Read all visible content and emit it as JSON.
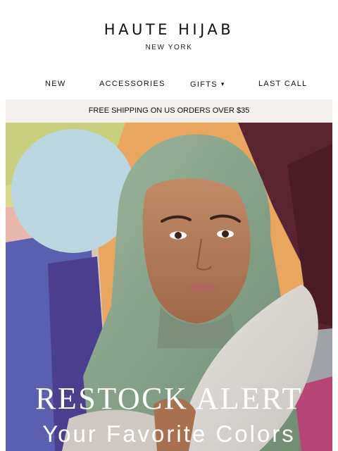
{
  "brand": {
    "title": "HAUTE HIJAB",
    "subtitle": "NEW YORK"
  },
  "nav": {
    "items": [
      {
        "label": "NEW"
      },
      {
        "label": "ACCESSORIES"
      },
      {
        "label": "GIFTS",
        "icon": "chevron-down-icon"
      },
      {
        "label": "LAST CALL"
      }
    ]
  },
  "banner": {
    "text": "FREE SHIPPING ON US ORDERS OVER $35"
  },
  "hero": {
    "headline": "RESTOCK ALERT",
    "subheadline": "Your Favorite Colors"
  },
  "colors": {
    "banner_bg": "#f3efec",
    "hijab": "#8aa58c",
    "circle": "#bcd6e0",
    "orange": "#e8a660",
    "plum": "#5a2530"
  }
}
